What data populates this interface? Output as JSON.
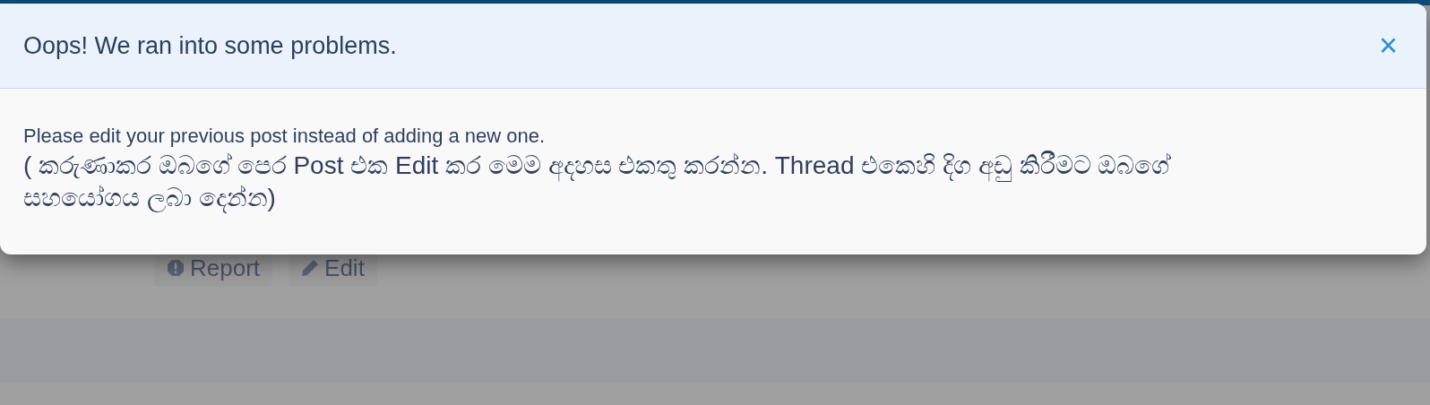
{
  "background": {
    "buttons": [
      {
        "kind": "report",
        "label": "Report"
      },
      {
        "kind": "edit",
        "label": "Edit"
      }
    ]
  },
  "dialog": {
    "title": "Oops! We ran into some problems.",
    "close": "×",
    "message": "Please edit your previous post instead of adding a new one.",
    "note": "( කරුණාකර ඔබගේ පෙර Post එක Edit කර මෙම අදහස එකතු කරන්න. Thread එකෙහි දිග අඩු කිරීමට ඔබගේ සහයෝගය ලබා දෙන්න)"
  }
}
